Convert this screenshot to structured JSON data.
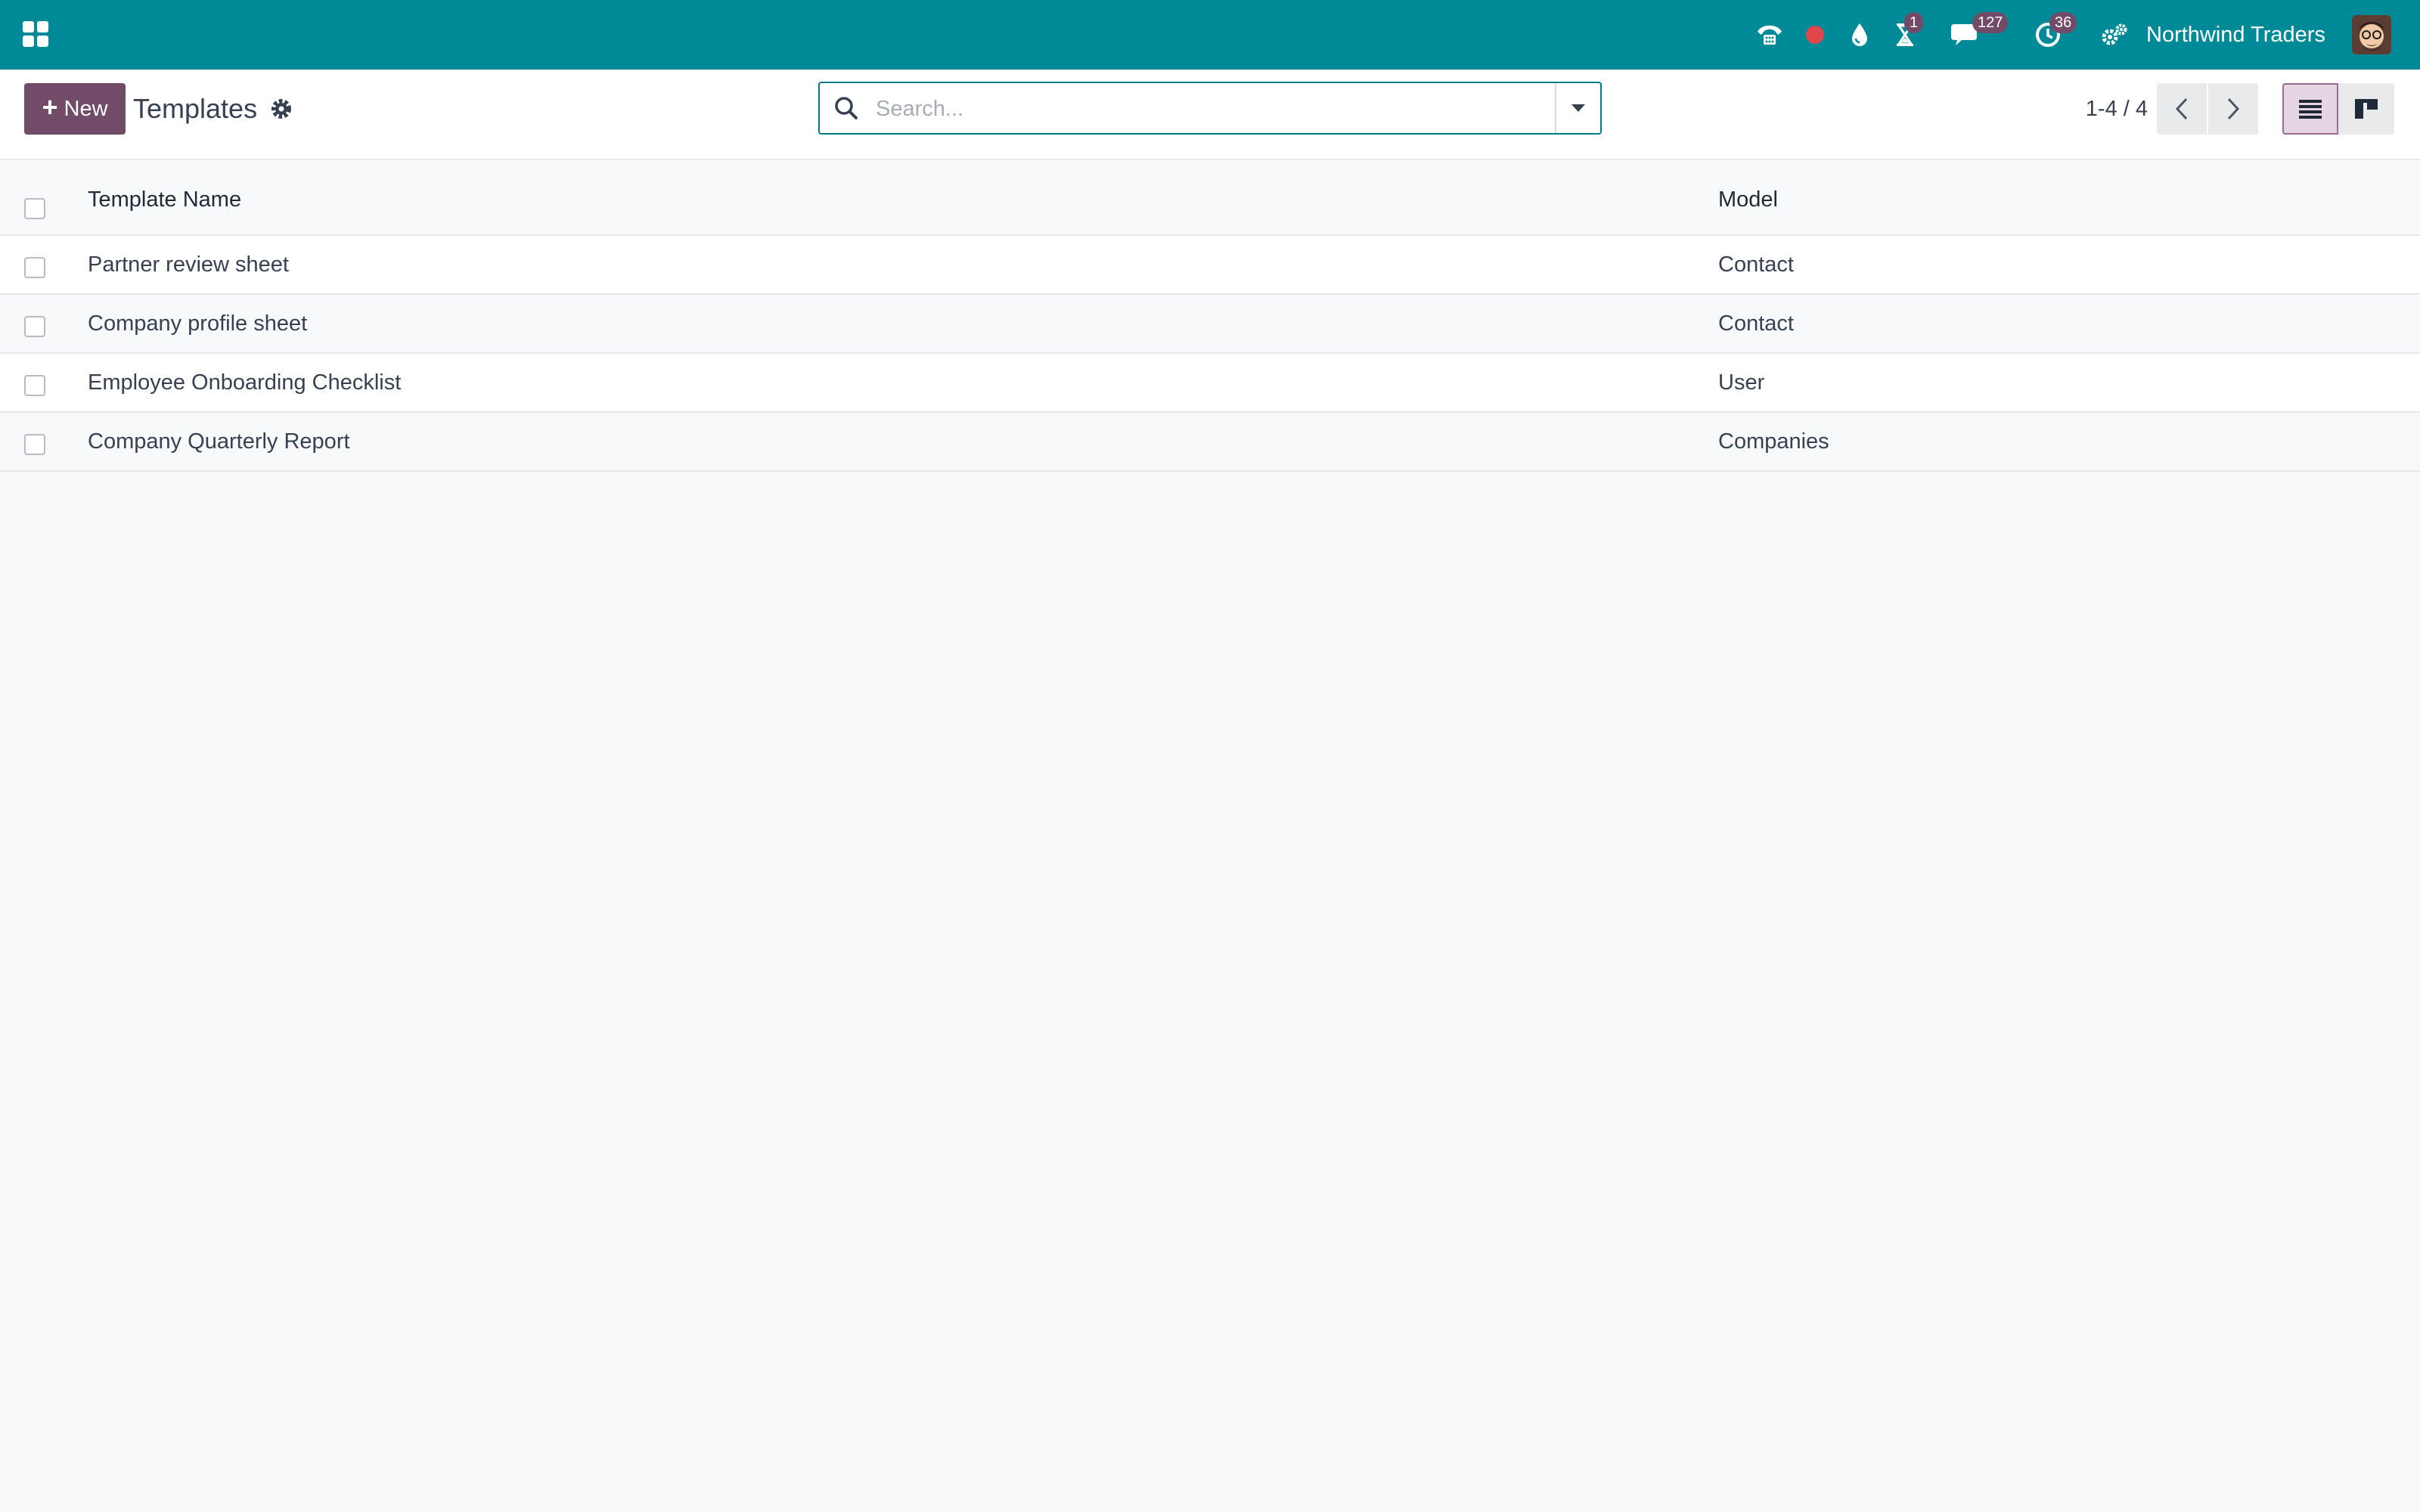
{
  "navbar": {
    "company": "Northwind Traders",
    "badges": {
      "activity": "1",
      "messages": "127",
      "timer": "36"
    },
    "colors": {
      "navbar": "#008a97",
      "accent": "#714b67",
      "status_dot": "#e0474c"
    },
    "icons": [
      "apps-grid-icon",
      "phone-icon",
      "status-dot-icon",
      "drop-icon",
      "hourglass-icon",
      "chat-icon",
      "clock-icon",
      "settings-cogs-icon",
      "user-avatar"
    ]
  },
  "control_panel": {
    "new_label": "New",
    "title": "Templates",
    "search_placeholder": "Search...",
    "pager": "1-4 / 4"
  },
  "table": {
    "columns": [
      "Template Name",
      "Model"
    ],
    "rows": [
      {
        "name": "Partner review sheet",
        "model": "Contact"
      },
      {
        "name": "Company profile sheet",
        "model": "Contact"
      },
      {
        "name": "Employee Onboarding Checklist",
        "model": "User"
      },
      {
        "name": "Company Quarterly Report",
        "model": "Companies"
      }
    ]
  }
}
